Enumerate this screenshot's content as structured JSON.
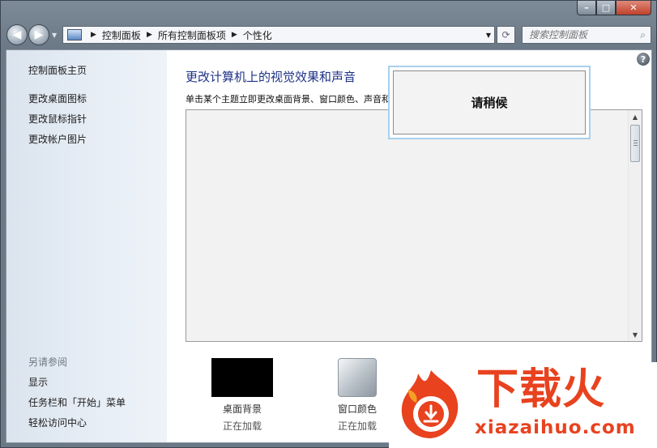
{
  "window": {
    "buttons": {
      "minimize": "–",
      "maximize": "□",
      "close": "✕"
    }
  },
  "nav": {
    "breadcrumbs": [
      "控制面板",
      "所有控制面板项",
      "个性化"
    ],
    "search_placeholder": "搜索控制面板"
  },
  "sidebar": {
    "home": "控制面板主页",
    "links": [
      "更改桌面图标",
      "更改鼠标指针",
      "更改帐户图片"
    ],
    "see_also_heading": "另请参阅",
    "see_also": [
      "显示",
      "任务栏和「开始」菜单",
      "轻松访问中心"
    ]
  },
  "main": {
    "title": "更改计算机上的视觉效果和声音",
    "description": "单击某个主题立即更改桌面背景、窗口颜色、声音和屏幕保护程序。",
    "bottom_items": [
      {
        "label": "桌面背景",
        "status": "正在加载"
      },
      {
        "label": "窗口颜色",
        "status": "正在加载"
      }
    ]
  },
  "dialog": {
    "text": "请稍候"
  },
  "watermark": {
    "title": "下载火",
    "domain": "xiazaihuo.com"
  },
  "colors": {
    "title_blue": "#1e3287",
    "watermark_red": "#e8421f"
  }
}
